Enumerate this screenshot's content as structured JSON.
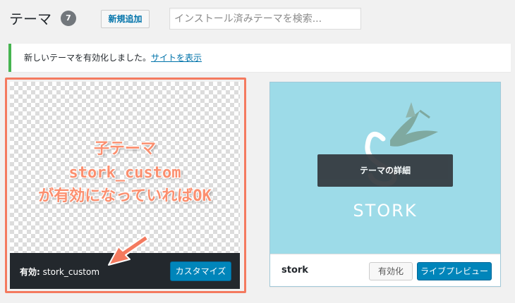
{
  "header": {
    "title": "テーマ",
    "count": "7",
    "add_new_label": "新規追加",
    "search_placeholder": "インストール済みテーマを検索..."
  },
  "notice": {
    "message": "新しいテーマを有効化しました。",
    "link_label": "サイトを表示"
  },
  "active_theme": {
    "status_label": "有効:",
    "name": "stork_custom",
    "customize_label": "カスタマイズ"
  },
  "annotation": {
    "line1": "子テーマ",
    "line2": "stork_custom",
    "line3": "が有効になっていればOK",
    "arrow_icon": "arrow-icon"
  },
  "stork_theme": {
    "logo_text": "STORK",
    "details_label": "テーマの詳細",
    "name": "stork",
    "activate_label": "有効化",
    "live_preview_label": "ライブプレビュー"
  },
  "colors": {
    "accent_blue": "#0085ba",
    "link_blue": "#0073aa",
    "notice_green": "#46b450",
    "annotation_orange": "#f47a5f",
    "stork_bg": "#9ddbe8",
    "dark_bar": "#23282d"
  }
}
